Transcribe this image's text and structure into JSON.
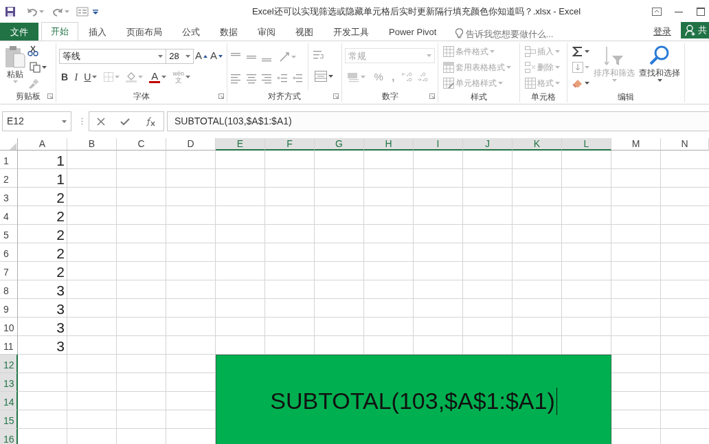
{
  "window": {
    "title": "Excel还可以实现筛选或隐藏单元格后实时更新隔行填充颜色你知道吗？.xlsx - Excel"
  },
  "tabs": [
    {
      "label": "文件",
      "kind": "file",
      "selected": false
    },
    {
      "label": "开始",
      "kind": "tab",
      "selected": true
    },
    {
      "label": "插入",
      "kind": "tab",
      "selected": false
    },
    {
      "label": "页面布局",
      "kind": "tab",
      "selected": false
    },
    {
      "label": "公式",
      "kind": "tab",
      "selected": false
    },
    {
      "label": "数据",
      "kind": "tab",
      "selected": false
    },
    {
      "label": "审阅",
      "kind": "tab",
      "selected": false
    },
    {
      "label": "视图",
      "kind": "tab",
      "selected": false
    },
    {
      "label": "开发工具",
      "kind": "tab",
      "selected": false
    },
    {
      "label": "Power Pivot",
      "kind": "tab",
      "selected": false
    }
  ],
  "tell_me": {
    "placeholder": "告诉我您想要做什么..."
  },
  "account": {
    "sign_in": "登录",
    "share": "共"
  },
  "ribbon": {
    "clipboard": {
      "label": "剪贴板",
      "paste": "粘贴"
    },
    "font": {
      "label": "字体",
      "name": "等线",
      "size": "28",
      "grow": "A",
      "shrink": "A",
      "bold": "B",
      "italic": "I",
      "underline": "U",
      "font_color": "A",
      "phonetic": "wén",
      "phonetic_char": "文"
    },
    "alignment": {
      "label": "对齐方式"
    },
    "number": {
      "label": "数字",
      "format": "常规",
      "percent": "%",
      "comma": ",",
      "disabled": true
    },
    "styles": {
      "label": "样式",
      "disabled": true,
      "items": [
        "条件格式",
        "套用表格格式",
        "单元格样式"
      ]
    },
    "cells": {
      "label": "单元格",
      "disabled": true,
      "items": [
        "插入",
        "删除",
        "格式"
      ]
    },
    "editing": {
      "label": "编辑",
      "items": [
        {
          "label": "排序和筛选",
          "disabled": true
        },
        {
          "label": "查找和选择",
          "disabled": false
        }
      ]
    }
  },
  "formula_bar": {
    "name_box": "E12",
    "formula": "SUBTOTAL(103,$A$1:$A1)"
  },
  "sheet": {
    "columns": [
      {
        "label": "A",
        "selected": false
      },
      {
        "label": "B",
        "selected": false
      },
      {
        "label": "C",
        "selected": false
      },
      {
        "label": "D",
        "selected": false
      },
      {
        "label": "E",
        "selected": true
      },
      {
        "label": "F",
        "selected": true
      },
      {
        "label": "G",
        "selected": true
      },
      {
        "label": "H",
        "selected": true
      },
      {
        "label": "I",
        "selected": true
      },
      {
        "label": "J",
        "selected": true
      },
      {
        "label": "K",
        "selected": true
      },
      {
        "label": "L",
        "selected": true
      },
      {
        "label": "M",
        "selected": false
      },
      {
        "label": "N",
        "selected": false
      }
    ],
    "rows": [
      {
        "label": "1",
        "selected": false,
        "value": "1"
      },
      {
        "label": "2",
        "selected": false,
        "value": "1"
      },
      {
        "label": "3",
        "selected": false,
        "value": "2"
      },
      {
        "label": "4",
        "selected": false,
        "value": "2"
      },
      {
        "label": "5",
        "selected": false,
        "value": "2"
      },
      {
        "label": "6",
        "selected": false,
        "value": "2"
      },
      {
        "label": "7",
        "selected": false,
        "value": "2"
      },
      {
        "label": "8",
        "selected": false,
        "value": "3"
      },
      {
        "label": "9",
        "selected": false,
        "value": "3"
      },
      {
        "label": "10",
        "selected": false,
        "value": "3"
      },
      {
        "label": "11",
        "selected": false,
        "value": "3"
      },
      {
        "label": "12",
        "selected": true
      },
      {
        "label": "13",
        "selected": true
      },
      {
        "label": "14",
        "selected": true
      },
      {
        "label": "15",
        "selected": true
      },
      {
        "label": "16",
        "selected": true
      }
    ],
    "editing_cell": {
      "text": "SUBTOTAL(103,$A$1:$A1)"
    }
  }
}
